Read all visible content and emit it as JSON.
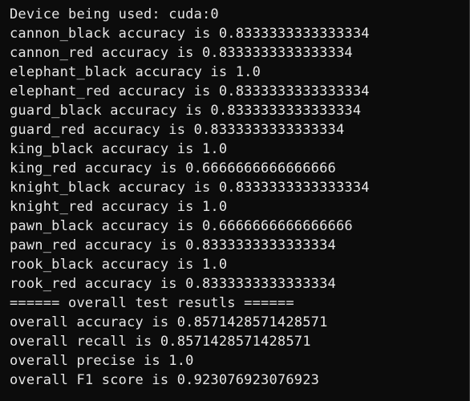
{
  "terminal": {
    "partial_line_above": "",
    "lines": [
      "Device being used: cuda:0",
      "cannon_black accuracy is 0.8333333333333334",
      "cannon_red accuracy is 0.8333333333333334",
      "elephant_black accuracy is 1.0",
      "elephant_red accuracy is 0.8333333333333334",
      "guard_black accuracy is 0.8333333333333334",
      "guard_red accuracy is 0.8333333333333334",
      "king_black accuracy is 1.0",
      "king_red accuracy is 0.6666666666666666",
      "knight_black accuracy is 0.8333333333333334",
      "knight_red accuracy is 1.0",
      "pawn_black accuracy is 0.6666666666666666",
      "pawn_red accuracy is 0.8333333333333334",
      "rook_black accuracy is 1.0",
      "rook_red accuracy is 0.8333333333333334",
      "====== overall test resutls ======",
      "overall accuracy is 0.8571428571428571",
      "overall recall is 0.8571428571428571",
      "overall precise is 1.0",
      "overall F1 score is 0.923076923076923"
    ]
  },
  "colors": {
    "background": "#0c0c0c",
    "text": "#e6e6e6"
  }
}
